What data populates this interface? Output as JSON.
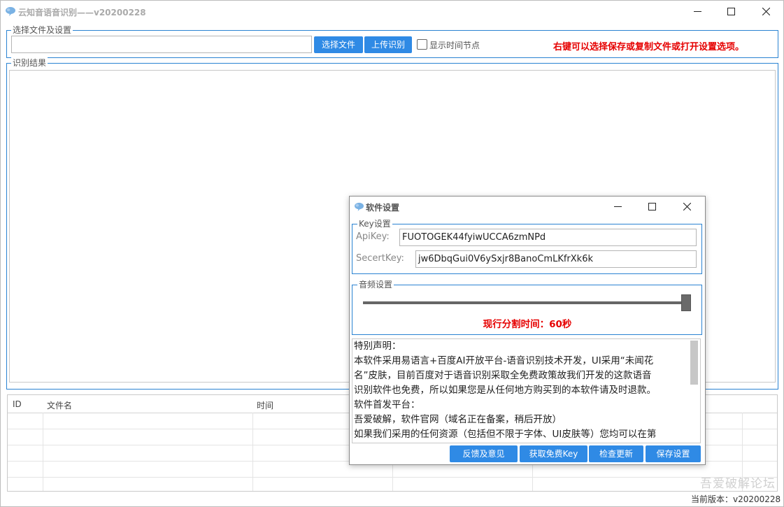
{
  "window": {
    "title": "云知音语音识别——v20200228"
  },
  "file_group": {
    "legend": "选择文件及设置",
    "path_value": "",
    "select_btn": "选择文件",
    "upload_btn": "上传识别",
    "show_time_label": "显示时间节点",
    "show_time_checked": false,
    "hint": "右键可以选择保存或复制文件或打开设置选项。"
  },
  "result_group": {
    "legend": "识别结果",
    "text": ""
  },
  "table": {
    "columns": [
      "ID",
      "文件名",
      "时间"
    ],
    "rows": []
  },
  "settings": {
    "title": "软件设置",
    "key_legend": "Key设置",
    "apikey_label": "ApiKey:",
    "apikey_value": "FUOTOGEK44fyiwUCCA6zmNPd",
    "secret_label": "SecertKey:",
    "secret_value": "jw6DbqGui0V6ySxjr8BanoCmLKfrXk6k",
    "audio_legend": "音频设置",
    "slider_fraction": 1.0,
    "split_text": "现行分割时间：60秒",
    "notice_lines": [
      "特别声明：",
      "本软件采用易语言+百度AI开放平台-语音识别技术开发，UI采用“未闻花",
      "名”皮肤，目前百度对于语音识别采取全免费政策故我们开发的这款语音",
      "识别软件也免费，所以如果您是从任何地方购买到的本软件请及时退款。",
      "软件首发平台：",
      "吾爱破解，软件官网（域名正在备案，稍后开放）",
      "如果我们采用的任何资源（包括但不限于字体、UI皮肤等）您均可以在第"
    ],
    "buttons": {
      "feedback": "反馈及意见",
      "get_key": "获取免费Key",
      "check_update": "检查更新",
      "save": "保存设置"
    }
  },
  "watermark": "吾爱破解论坛",
  "version": "当前版本：v20200228",
  "colors": {
    "accent": "#2f8ae5",
    "hint_red": "#e60000",
    "group_border": "#2a83d2"
  }
}
